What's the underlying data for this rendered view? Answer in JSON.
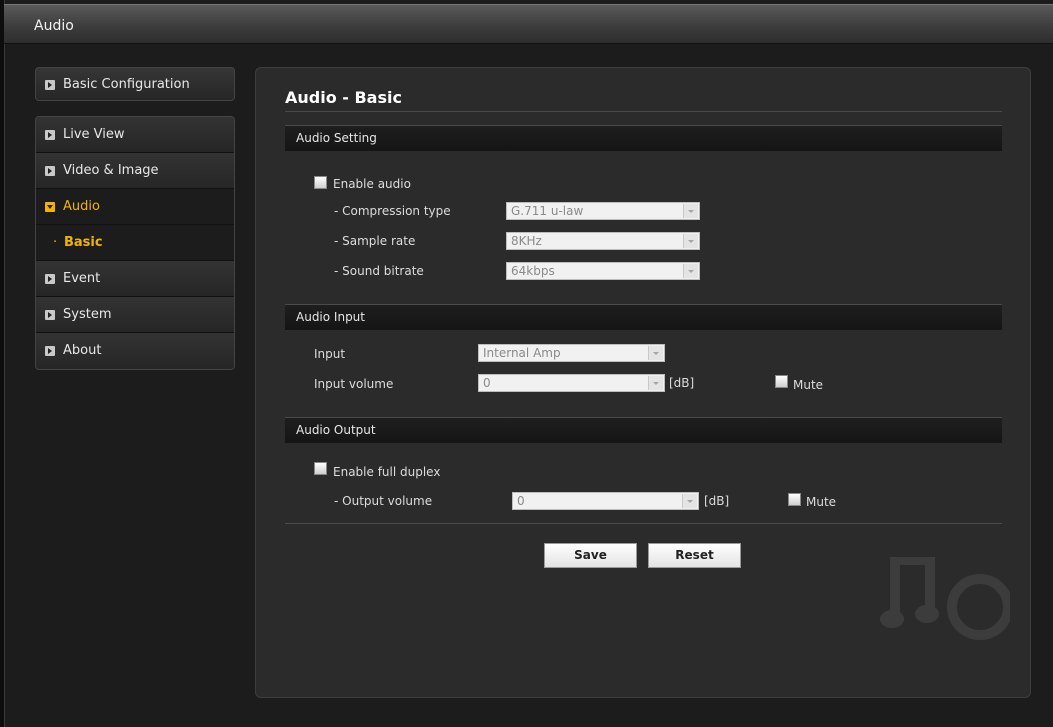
{
  "window": {
    "title": "Audio"
  },
  "sidebar": {
    "top_item": {
      "label": "Basic Configuration"
    },
    "items": [
      {
        "label": "Live View",
        "state": "collapsed"
      },
      {
        "label": "Video & Image",
        "state": "collapsed"
      },
      {
        "label": "Audio",
        "state": "expanded"
      },
      {
        "label": "Basic",
        "state": "selected-sub"
      },
      {
        "label": "Event",
        "state": "collapsed"
      },
      {
        "label": "System",
        "state": "collapsed"
      },
      {
        "label": "About",
        "state": "collapsed"
      }
    ],
    "sub_bullet": "·"
  },
  "page": {
    "title": "Audio - Basic"
  },
  "audio_setting": {
    "header": "Audio Setting",
    "enable_audio_label": "Enable audio",
    "enable_audio_checked": false,
    "compression_label": "- Compression type",
    "compression_value": "G.711 u-law",
    "sample_rate_label": "- Sample rate",
    "sample_rate_value": "8KHz",
    "sound_bitrate_label": "- Sound bitrate",
    "sound_bitrate_value": "64kbps"
  },
  "audio_input": {
    "header": "Audio Input",
    "input_label": "Input",
    "input_value": "Internal Amp",
    "volume_label": "Input volume",
    "volume_value": "0",
    "volume_unit": "[dB]",
    "mute_label": "Mute",
    "mute_checked": false
  },
  "audio_output": {
    "header": "Audio Output",
    "full_duplex_label": "Enable full duplex",
    "full_duplex_checked": false,
    "volume_label": "- Output volume",
    "volume_value": "0",
    "volume_unit": "[dB]",
    "mute_label": "Mute",
    "mute_checked": false
  },
  "actions": {
    "save_label": "Save",
    "reset_label": "Reset"
  },
  "colors": {
    "accent": "#f2b400",
    "background": "#1c1c1c",
    "panel": "#2b2b2b"
  }
}
